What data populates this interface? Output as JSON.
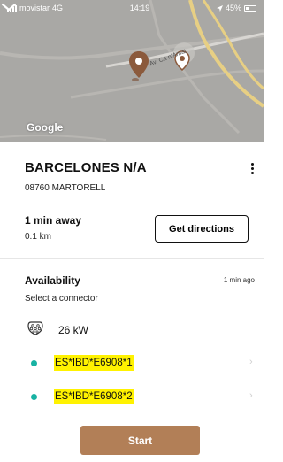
{
  "status_bar": {
    "carrier": "movistar",
    "network": "4G",
    "time": "14:19",
    "battery": "45%",
    "battery_level": 0.45
  },
  "map": {
    "road_label": "Av. Ca n'Amat",
    "attribution": "Google",
    "colors": {
      "background": "#a9a8a5",
      "road": "#e7cf84",
      "pin": "#8b5a3c"
    }
  },
  "place": {
    "title": "BARCELONES N/A",
    "address": "08760 MARTORELL"
  },
  "travel": {
    "eta": "1 min away",
    "distance": "0.1 km",
    "directions_label": "Get directions"
  },
  "availability": {
    "title": "Availability",
    "updated": "1 min ago",
    "subtitle": "Select a connector",
    "connector_type_icon": "type2-connector-icon",
    "power": "26 kW",
    "connectors": [
      {
        "id": "ES*IBD*E6908*1",
        "status_color": "#18b2a3"
      },
      {
        "id": "ES*IBD*E6908*2",
        "status_color": "#18b2a3"
      }
    ]
  },
  "actions": {
    "start_label": "Start",
    "start_color": "#b27f57"
  }
}
